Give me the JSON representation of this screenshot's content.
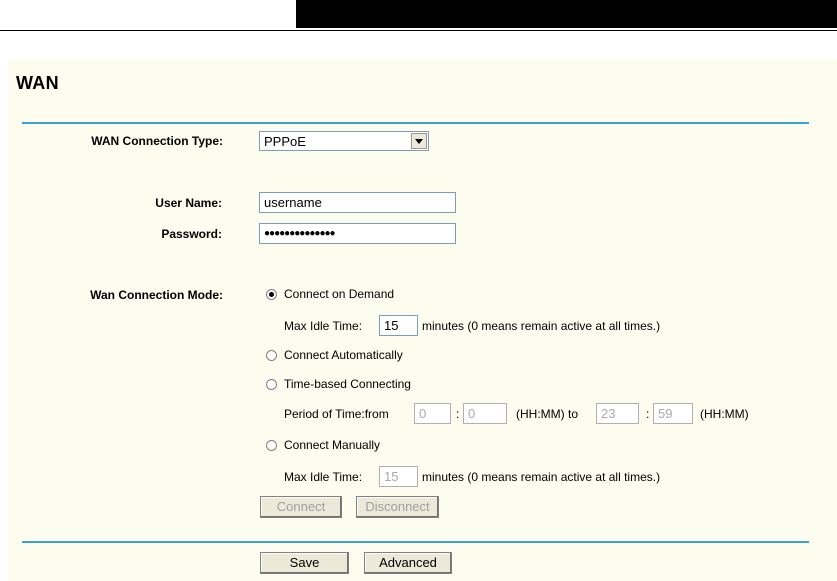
{
  "page": {
    "title": "WAN"
  },
  "form": {
    "connection_type_label": "WAN Connection Type:",
    "connection_type_value": "PPPoE",
    "username_label": "User Name:",
    "username_value": "username",
    "password_label": "Password:",
    "password_value": "●●●●●●●●●●●●●●",
    "mode_label": "Wan Connection Mode:",
    "modes": [
      {
        "label": "Connect on Demand",
        "selected": true
      },
      {
        "label": "Connect Automatically",
        "selected": false
      },
      {
        "label": "Time-based Connecting",
        "selected": false
      },
      {
        "label": "Connect Manually",
        "selected": false
      }
    ],
    "demand_idle_label": "Max Idle Time:",
    "demand_idle_value": "15",
    "demand_idle_suffix": "minutes (0 means remain active at all times.)",
    "period_label": "Period of Time:from",
    "period_from_hh": "0",
    "period_sep1": ":",
    "period_from_mm": "0",
    "period_to_label": "(HH:MM) to",
    "period_to_hh": "23",
    "period_sep2": ":",
    "period_to_mm": "59",
    "period_end_label": "(HH:MM)",
    "manual_idle_label": "Max Idle Time:",
    "manual_idle_value": "15",
    "manual_idle_suffix": "minutes (0 means remain active at all times.)",
    "connect_button": "Connect",
    "disconnect_button": "Disconnect"
  },
  "footer": {
    "save_button": "Save",
    "advanced_button": "Advanced"
  },
  "colors": {
    "panel_bg": "#fcfcef",
    "rule": "#3aa3d6"
  }
}
